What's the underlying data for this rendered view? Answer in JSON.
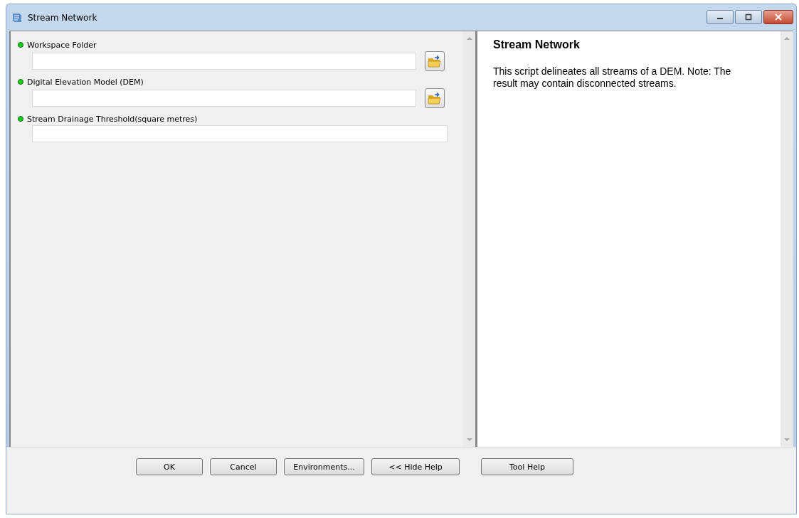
{
  "window": {
    "title": "Stream Network"
  },
  "parameters": [
    {
      "label": "Workspace Folder",
      "required": true,
      "kind": "browse"
    },
    {
      "label": "Digital Elevation Model (DEM)",
      "required": true,
      "kind": "browse"
    },
    {
      "label": "Stream Drainage Threshold(square metres)",
      "required": true,
      "kind": "text"
    }
  ],
  "help": {
    "title": "Stream Network",
    "text": "This script delineates all streams of a DEM. Note: The result may contain disconnected streams."
  },
  "buttons": [
    {
      "label": "OK",
      "kind": "main"
    },
    {
      "label": "Cancel",
      "kind": "main"
    },
    {
      "label": "Environments...",
      "kind": "main"
    },
    {
      "label": "<< Hide Help",
      "kind": "main"
    },
    {
      "label": "Tool Help",
      "kind": "side"
    }
  ]
}
